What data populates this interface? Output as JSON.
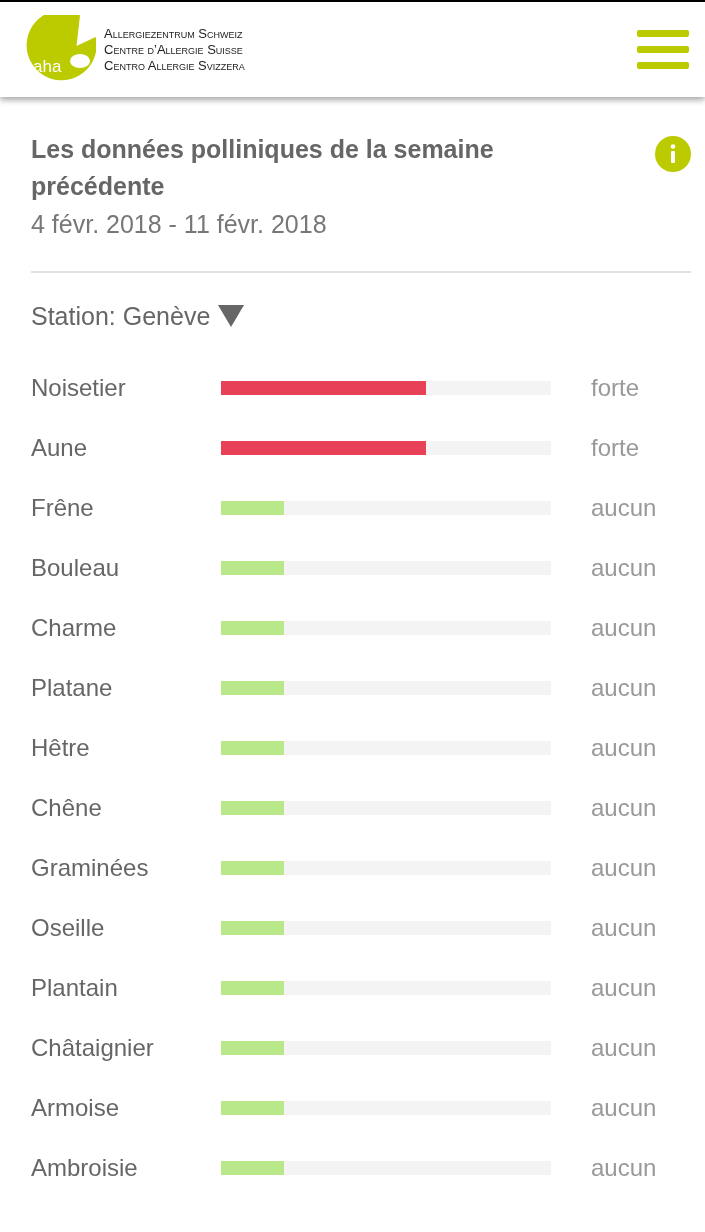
{
  "header": {
    "logo_text": "aha",
    "organization": [
      "Allergiezentrum Schweiz",
      "Centre d’Allergie Suisse",
      "Centro Allergie Svizzera"
    ]
  },
  "report": {
    "title": "Les données polliniques de la semaine précédente",
    "period": "4 févr. 2018 - 11 févr. 2018"
  },
  "station": {
    "label": "Station: Genève"
  },
  "pollen": [
    {
      "name": "Noisetier",
      "level": 0.62,
      "color": "#e84057",
      "reading": "forte"
    },
    {
      "name": "Aune",
      "level": 0.62,
      "color": "#e84057",
      "reading": "forte"
    },
    {
      "name": "Frêne",
      "level": 0.19,
      "color": "#b9e88a",
      "reading": "aucun"
    },
    {
      "name": "Bouleau",
      "level": 0.19,
      "color": "#b9e88a",
      "reading": "aucun"
    },
    {
      "name": "Charme",
      "level": 0.19,
      "color": "#b9e88a",
      "reading": "aucun"
    },
    {
      "name": "Platane",
      "level": 0.19,
      "color": "#b9e88a",
      "reading": "aucun"
    },
    {
      "name": "Hêtre",
      "level": 0.19,
      "color": "#b9e88a",
      "reading": "aucun"
    },
    {
      "name": "Chêne",
      "level": 0.19,
      "color": "#b9e88a",
      "reading": "aucun"
    },
    {
      "name": "Graminées",
      "level": 0.19,
      "color": "#b9e88a",
      "reading": "aucun"
    },
    {
      "name": "Oseille",
      "level": 0.19,
      "color": "#b9e88a",
      "reading": "aucun"
    },
    {
      "name": "Plantain",
      "level": 0.19,
      "color": "#b9e88a",
      "reading": "aucun"
    },
    {
      "name": "Châtaignier",
      "level": 0.19,
      "color": "#b9e88a",
      "reading": "aucun"
    },
    {
      "name": "Armoise",
      "level": 0.19,
      "color": "#b9e88a",
      "reading": "aucun"
    },
    {
      "name": "Ambroisie",
      "level": 0.19,
      "color": "#b9e88a",
      "reading": "aucun"
    }
  ]
}
